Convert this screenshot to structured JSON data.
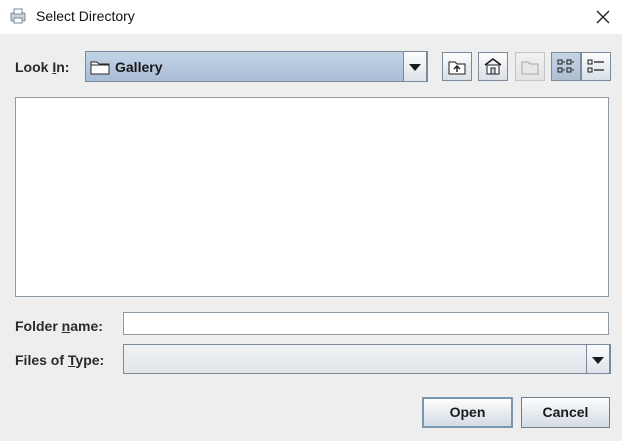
{
  "window": {
    "title": "Select Directory",
    "app_icon": "printer-icon",
    "close_icon": "close-icon"
  },
  "look_in": {
    "label_pre": "Look ",
    "label_mnemonic": "I",
    "label_post": "n:",
    "value": "Gallery",
    "value_icon": "folder-icon"
  },
  "toolbar": [
    {
      "name": "up-one-level-button",
      "icon": "folder-up-icon",
      "enabled": true
    },
    {
      "name": "home-button",
      "icon": "home-icon",
      "enabled": true
    },
    {
      "name": "new-folder-button",
      "icon": "new-folder-icon",
      "enabled": false
    },
    {
      "name": "list-view-button",
      "icon": "list-view-icon",
      "enabled": true,
      "selected": true
    },
    {
      "name": "details-view-button",
      "icon": "details-view-icon",
      "enabled": true
    }
  ],
  "file_list": {
    "items": []
  },
  "folder_name": {
    "label_pre": "Folder ",
    "label_mnemonic": "n",
    "label_post": "ame:",
    "value": ""
  },
  "files_of_type": {
    "label_pre": "Files of ",
    "label_mnemonic": "T",
    "label_post": "ype:",
    "value": ""
  },
  "buttons": {
    "open_label": "Open",
    "cancel_label": "Cancel"
  }
}
